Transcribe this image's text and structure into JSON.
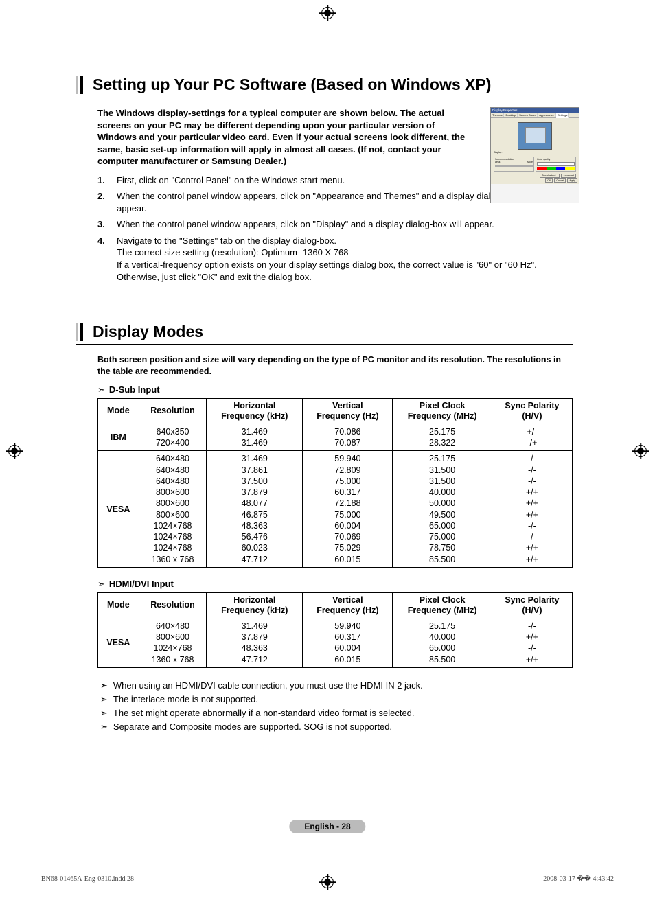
{
  "section1": {
    "title": "Setting up Your PC Software (Based on Windows XP)",
    "intro": "The Windows display-settings for a typical computer are shown below. The actual screens on your PC may be different depending upon your particular version of Windows and your particular video card. Even if your actual screens look different, the same, basic set-up information will apply in almost all cases. (If not, contact your computer manufacturer or Samsung Dealer.)",
    "steps": [
      "First, click on \"Control Panel\" on the Windows start menu.",
      "When the control panel window appears, click on \"Appearance and Themes\" and a display dialog-box will appear.",
      "When the control panel window appears, click on \"Display\" and a display dialog-box will appear.",
      "Navigate to the \"Settings\" tab on the display dialog-box.\nThe correct size setting (resolution): Optimum- 1360 X 768\nIf a vertical-frequency option exists on your display settings dialog box, the correct value is \"60\" or \"60 Hz\". Otherwise, just click \"OK\" and exit the dialog box."
    ],
    "fig": {
      "title": "Display Properties",
      "tabs": [
        "Themes",
        "Desktop",
        "Screen Saver",
        "Appearance",
        "Settings"
      ],
      "display_label": "Display:",
      "res_label": "Screen resolution",
      "less": "Less",
      "more": "More",
      "quality_label": "Color quality",
      "troubleshoot": "Troubleshoot...",
      "advanced": "Advanced",
      "ok": "OK",
      "cancel": "Cancel",
      "apply": "Apply"
    }
  },
  "section2": {
    "title": "Display Modes",
    "intro": "Both screen position and size will vary depending on the type of PC monitor and its resolution. The resolutions in the table are recommended.",
    "sub1": "D-Sub Input",
    "sub2": "HDMI/DVI Input",
    "headers": {
      "mode": "Mode",
      "res": "Resolution",
      "hfreq": "Horizontal\nFrequency (kHz)",
      "vfreq": "Vertical\nFrequency (Hz)",
      "pclk": "Pixel Clock\nFrequency (MHz)",
      "sync": "Sync Polarity\n(H/V)"
    },
    "dsub": {
      "groups": [
        {
          "mode": "IBM",
          "rows": [
            {
              "res": "640x350",
              "h": "31.469",
              "v": "70.086",
              "p": "25.175",
              "s": "+/-"
            },
            {
              "res": "720×400",
              "h": "31.469",
              "v": "70.087",
              "p": "28.322",
              "s": "-/+"
            }
          ]
        },
        {
          "mode": "VESA",
          "rows": [
            {
              "res": "640×480",
              "h": "31.469",
              "v": "59.940",
              "p": "25.175",
              "s": "-/-"
            },
            {
              "res": "640×480",
              "h": "37.861",
              "v": "72.809",
              "p": "31.500",
              "s": "-/-"
            },
            {
              "res": "640×480",
              "h": "37.500",
              "v": "75.000",
              "p": "31.500",
              "s": "-/-"
            },
            {
              "res": "800×600",
              "h": "37.879",
              "v": "60.317",
              "p": "40.000",
              "s": "+/+"
            },
            {
              "res": "800×600",
              "h": "48.077",
              "v": "72.188",
              "p": "50.000",
              "s": "+/+"
            },
            {
              "res": "800×600",
              "h": "46.875",
              "v": "75.000",
              "p": "49.500",
              "s": "+/+"
            },
            {
              "res": "1024×768",
              "h": "48.363",
              "v": "60.004",
              "p": "65.000",
              "s": "-/-"
            },
            {
              "res": "1024×768",
              "h": "56.476",
              "v": "70.069",
              "p": "75.000",
              "s": "-/-"
            },
            {
              "res": "1024×768",
              "h": "60.023",
              "v": "75.029",
              "p": "78.750",
              "s": "+/+"
            },
            {
              "res": "1360 x 768",
              "h": "47.712",
              "v": "60.015",
              "p": "85.500",
              "s": "+/+"
            }
          ]
        }
      ]
    },
    "hdmi": {
      "groups": [
        {
          "mode": "VESA",
          "rows": [
            {
              "res": "640×480",
              "h": "31.469",
              "v": "59.940",
              "p": "25.175",
              "s": "-/-"
            },
            {
              "res": "800×600",
              "h": "37.879",
              "v": "60.317",
              "p": "40.000",
              "s": "+/+"
            },
            {
              "res": "1024×768",
              "h": "48.363",
              "v": "60.004",
              "p": "65.000",
              "s": "-/-"
            },
            {
              "res": "1360 x 768",
              "h": "47.712",
              "v": "60.015",
              "p": "85.500",
              "s": "+/+"
            }
          ]
        }
      ]
    },
    "notes": [
      "When using an HDMI/DVI cable connection, you must use the HDMI IN 2 jack.",
      "The interlace mode is not supported.",
      "The set might operate abnormally if a non-standard video format is selected.",
      "Separate and Composite modes are supported. SOG is not supported."
    ]
  },
  "footer": {
    "page": "English - 28",
    "file": "BN68-01465A-Eng-0310.indd   28",
    "date": "2008-03-17   �� 4:43:42"
  }
}
